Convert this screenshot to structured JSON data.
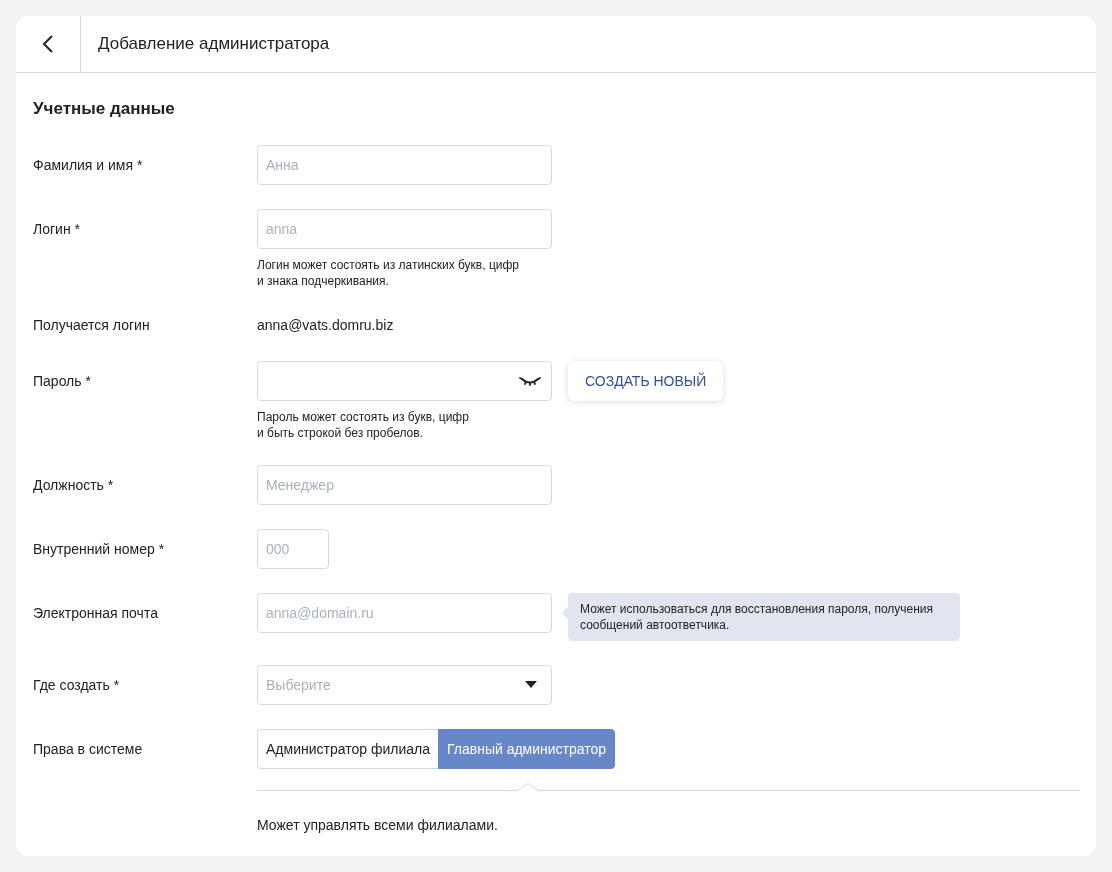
{
  "header": {
    "title": "Добавление администратора"
  },
  "section": {
    "title": "Учетные данные"
  },
  "fields": [
    {
      "kind": "text",
      "label": "Фамилия и имя *",
      "placeholder": "Анна"
    },
    {
      "kind": "text",
      "label": "Логин *",
      "placeholder": "anna",
      "hint": [
        "Логин может состоять из латинских букв, цифр",
        "и знака подчеркивания."
      ]
    },
    {
      "kind": "value",
      "label": "Получается логин",
      "value": "anna@vats.domru.biz"
    },
    {
      "kind": "password",
      "label": "Пароль *",
      "button": "СОЗДАТЬ НОВЫЙ",
      "hint": [
        "Пароль может состоять из букв, цифр",
        "и быть строкой без пробелов."
      ]
    },
    {
      "kind": "text",
      "label": "Должность *",
      "placeholder": "Менеджер"
    },
    {
      "kind": "short",
      "label": "Внутренний номер *",
      "placeholder": "000"
    },
    {
      "kind": "text",
      "label": "Электронная почта",
      "placeholder": "anna@domain.ru",
      "tooltip": "Может использоваться для восстановления пароля, получения сообщений автоответчика."
    },
    {
      "kind": "select",
      "label": "Где создать *",
      "placeholder": "Выберите"
    },
    {
      "kind": "segmented",
      "label": "Права в системе",
      "options": [
        {
          "label": "Администратор филиала",
          "selected": false
        },
        {
          "label": "Главный администратор",
          "selected": true
        }
      ],
      "description": "Может управлять всеми филиалами."
    }
  ]
}
